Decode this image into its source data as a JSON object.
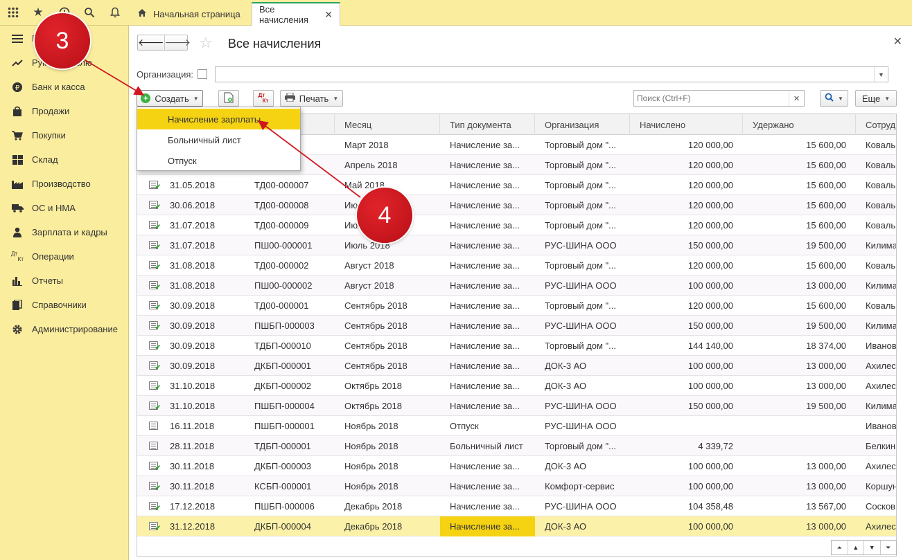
{
  "topbar": {
    "icons": [
      "apps-grid-icon",
      "favorites-star-icon",
      "history-icon",
      "search-icon",
      "notifications-bell-icon"
    ],
    "tabs": {
      "home": "Начальная страница",
      "active": "Все начисления"
    }
  },
  "sidebar": {
    "items": [
      {
        "label": "П",
        "icon": "menu-lines-icon"
      },
      {
        "label": "Руководителю",
        "icon": "trend-chart-icon"
      },
      {
        "label": "Банк и касса",
        "icon": "ruble-coin-icon"
      },
      {
        "label": "Продажи",
        "icon": "shopping-bag-icon"
      },
      {
        "label": "Покупки",
        "icon": "shopping-cart-icon"
      },
      {
        "label": "Склад",
        "icon": "warehouse-grid-icon"
      },
      {
        "label": "Производство",
        "icon": "factory-icon"
      },
      {
        "label": "ОС и НМА",
        "icon": "truck-icon"
      },
      {
        "label": "Зарплата и кадры",
        "icon": "people-icon"
      },
      {
        "label": "Операции",
        "icon": "dt-kt-icon"
      },
      {
        "label": "Отчеты",
        "icon": "bar-report-icon"
      },
      {
        "label": "Справочники",
        "icon": "books-icon"
      },
      {
        "label": "Администрирование",
        "icon": "gear-icon"
      }
    ]
  },
  "page": {
    "title": "Все начисления",
    "org_label": "Организация:",
    "create_label": "Создать",
    "print_label": "Печать",
    "search_placeholder": "Поиск (Ctrl+F)",
    "more_label": "Еще",
    "dtkt": "Дт\nКт"
  },
  "dropdown": {
    "items": [
      "Начисление зарплаты",
      "Больничный лист",
      "Отпуск"
    ],
    "active_index": 0
  },
  "table": {
    "columns": [
      "Месяц",
      "Тип документа",
      "Организация",
      "Начислено",
      "Удержано",
      "Сотруд"
    ],
    "rows": [
      {
        "date": "",
        "number": "05",
        "month": "Март 2018",
        "type": "Начисление за...",
        "org": "Торговый дом \"...",
        "accrued": "120 000,00",
        "withheld": "15 600,00",
        "employee": "Коваль",
        "posted": true
      },
      {
        "date": "",
        "number": "06",
        "month": "Апрель 2018",
        "type": "Начисление за...",
        "org": "Торговый дом \"...",
        "accrued": "120 000,00",
        "withheld": "15 600,00",
        "employee": "Коваль",
        "posted": true
      },
      {
        "date": "31.05.2018",
        "number": "ТД00-000007",
        "month": "Май 2018",
        "type": "Начисление за...",
        "org": "Торговый дом \"...",
        "accrued": "120 000,00",
        "withheld": "15 600,00",
        "employee": "Коваль",
        "posted": true
      },
      {
        "date": "30.06.2018",
        "number": "ТД00-000008",
        "month": "Июнь 2018",
        "type": "Начисление за...",
        "org": "Торговый дом \"...",
        "accrued": "120 000,00",
        "withheld": "15 600,00",
        "employee": "Коваль",
        "posted": true
      },
      {
        "date": "31.07.2018",
        "number": "ТД00-000009",
        "month": "Июль 2018",
        "type": "Начисление за...",
        "org": "Торговый дом \"...",
        "accrued": "120 000,00",
        "withheld": "15 600,00",
        "employee": "Коваль",
        "posted": true
      },
      {
        "date": "31.07.2018",
        "number": "ПШ00-000001",
        "month": "Июль 2018",
        "type": "Начисление за...",
        "org": "РУС-ШИНА ООО",
        "accrued": "150 000,00",
        "withheld": "19 500,00",
        "employee": "Килима",
        "posted": true
      },
      {
        "date": "31.08.2018",
        "number": "ТД00-000002",
        "month": "Август 2018",
        "type": "Начисление за...",
        "org": "Торговый дом \"...",
        "accrued": "120 000,00",
        "withheld": "15 600,00",
        "employee": "Коваль",
        "posted": true
      },
      {
        "date": "31.08.2018",
        "number": "ПШ00-000002",
        "month": "Август 2018",
        "type": "Начисление за...",
        "org": "РУС-ШИНА ООО",
        "accrued": "100 000,00",
        "withheld": "13 000,00",
        "employee": "Килима",
        "posted": true
      },
      {
        "date": "30.09.2018",
        "number": "ТД00-000001",
        "month": "Сентябрь 2018",
        "type": "Начисление за...",
        "org": "Торговый дом \"...",
        "accrued": "120 000,00",
        "withheld": "15 600,00",
        "employee": "Коваль",
        "posted": true
      },
      {
        "date": "30.09.2018",
        "number": "ПШБП-000003",
        "month": "Сентябрь 2018",
        "type": "Начисление за...",
        "org": "РУС-ШИНА ООО",
        "accrued": "150 000,00",
        "withheld": "19 500,00",
        "employee": "Килима",
        "posted": true
      },
      {
        "date": "30.09.2018",
        "number": "ТДБП-000010",
        "month": "Сентябрь 2018",
        "type": "Начисление за...",
        "org": "Торговый дом \"...",
        "accrued": "144 140,00",
        "withheld": "18 374,00",
        "employee": "Иванов",
        "posted": true
      },
      {
        "date": "30.09.2018",
        "number": "ДКБП-000001",
        "month": "Сентябрь 2018",
        "type": "Начисление за...",
        "org": "ДОК-3 АО",
        "accrued": "100 000,00",
        "withheld": "13 000,00",
        "employee": "Ахилес",
        "posted": true
      },
      {
        "date": "31.10.2018",
        "number": "ДКБП-000002",
        "month": "Октябрь 2018",
        "type": "Начисление за...",
        "org": "ДОК-3 АО",
        "accrued": "100 000,00",
        "withheld": "13 000,00",
        "employee": "Ахилес",
        "posted": true
      },
      {
        "date": "31.10.2018",
        "number": "ПШБП-000004",
        "month": "Октябрь 2018",
        "type": "Начисление за...",
        "org": "РУС-ШИНА ООО",
        "accrued": "150 000,00",
        "withheld": "19 500,00",
        "employee": "Килима",
        "posted": true
      },
      {
        "date": "16.11.2018",
        "number": "ПШБП-000001",
        "month": "Ноябрь 2018",
        "type": "Отпуск",
        "org": "РУС-ШИНА ООО",
        "accrued": "",
        "withheld": "",
        "employee": "Иванов",
        "posted": false
      },
      {
        "date": "28.11.2018",
        "number": "ТДБП-000001",
        "month": "Ноябрь 2018",
        "type": "Больничный лист",
        "org": "Торговый дом \"...",
        "accrued": "4 339,72",
        "withheld": "",
        "employee": "Белкин",
        "posted": false
      },
      {
        "date": "30.11.2018",
        "number": "ДКБП-000003",
        "month": "Ноябрь 2018",
        "type": "Начисление за...",
        "org": "ДОК-3 АО",
        "accrued": "100 000,00",
        "withheld": "13 000,00",
        "employee": "Ахилес",
        "posted": true
      },
      {
        "date": "30.11.2018",
        "number": "КСБП-000001",
        "month": "Ноябрь 2018",
        "type": "Начисление за...",
        "org": "Комфорт-сервис",
        "accrued": "100 000,00",
        "withheld": "13 000,00",
        "employee": "Коршун",
        "posted": true
      },
      {
        "date": "17.12.2018",
        "number": "ПШБП-000006",
        "month": "Декабрь 2018",
        "type": "Начисление за...",
        "org": "РУС-ШИНА ООО",
        "accrued": "104 358,48",
        "withheld": "13 567,00",
        "employee": "Сосков",
        "posted": true
      },
      {
        "date": "31.12.2018",
        "number": "ДКБП-000004",
        "month": "Декабрь 2018",
        "type": "Начисление за...",
        "org": "ДОК-3 АО",
        "accrued": "100 000,00",
        "withheld": "13 000,00",
        "employee": "Ахилес",
        "posted": true
      }
    ],
    "selected_index": 19
  },
  "annotations": {
    "badge3": "3",
    "badge4": "4",
    "color": "#d0161e"
  },
  "colors": {
    "panel_yellow": "#fbed9e",
    "highlight_yellow": "#f5d313",
    "selected_row": "#fcf1a8",
    "active_tab_accent": "#2aa35a"
  }
}
